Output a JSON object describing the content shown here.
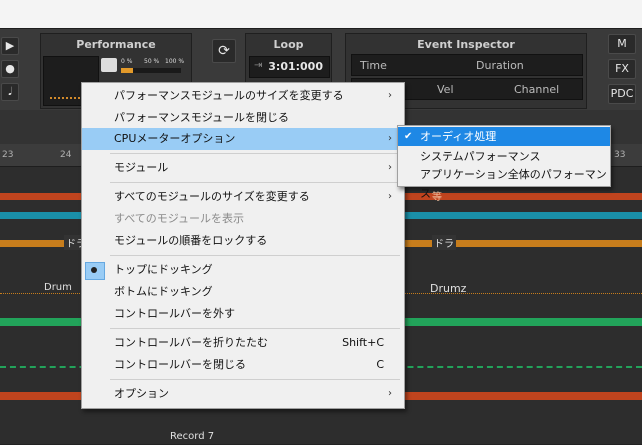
{
  "toolbar": {
    "transport": {
      "play": "▶",
      "record": "●",
      "metronome": "𝅘𝅥"
    },
    "performance": {
      "title": "Performance",
      "meter_labels": [
        "0 %",
        "50 %",
        "100 %"
      ],
      "mini_labels": [
        "0 %"
      ]
    },
    "loop": {
      "title": "Loop",
      "time": "3:01:000"
    },
    "event_inspector": {
      "title": "Event Inspector",
      "row1": [
        "Time",
        "Duration"
      ],
      "row2": [
        "Vel",
        "Channel"
      ]
    },
    "right_buttons": [
      "M",
      "FX",
      "PDC"
    ]
  },
  "ruler": {
    "numbers": [
      "23",
      "24",
      "33"
    ]
  },
  "tracks": {
    "labels": [
      "ドラ",
      "ドラ",
      "Drum",
      "Drumz",
      "Record 7",
      "等"
    ]
  },
  "context_menu": {
    "items": [
      {
        "label": "パフォーマンスモジュールのサイズを変更する",
        "arrow": "›"
      },
      {
        "label": "パフォーマンスモジュールを閉じる"
      },
      {
        "label": "CPUメーターオプション",
        "arrow": "›"
      },
      {
        "label": "モジュール",
        "arrow": "›"
      },
      {
        "label": "すべてのモジュールのサイズを変更する",
        "arrow": "›"
      },
      {
        "label": "すべてのモジュールを表示"
      },
      {
        "label": "モジュールの順番をロックする"
      },
      {
        "label": "トップにドッキング"
      },
      {
        "label": "ボトムにドッキング"
      },
      {
        "label": "コントロールバーを外す"
      },
      {
        "label": "コントロールバーを折りたたむ",
        "shortcut": "Shift+C"
      },
      {
        "label": "コントロールバーを閉じる",
        "shortcut": "C"
      },
      {
        "label": "オプション",
        "arrow": "›"
      }
    ]
  },
  "submenu": {
    "check": "✔",
    "items": [
      "オーディオ処理",
      "システムパフォーマンス",
      "アプリケーション全体のパフォーマンス"
    ]
  },
  "colors": {
    "menu_highlight": "#99ccf5",
    "submenu_selected": "#1e88e5",
    "lane_teal": "#1a8fa8",
    "lane_orange": "#c77d1c",
    "lane_green": "#22a35a",
    "lane_red": "#c0441e"
  }
}
